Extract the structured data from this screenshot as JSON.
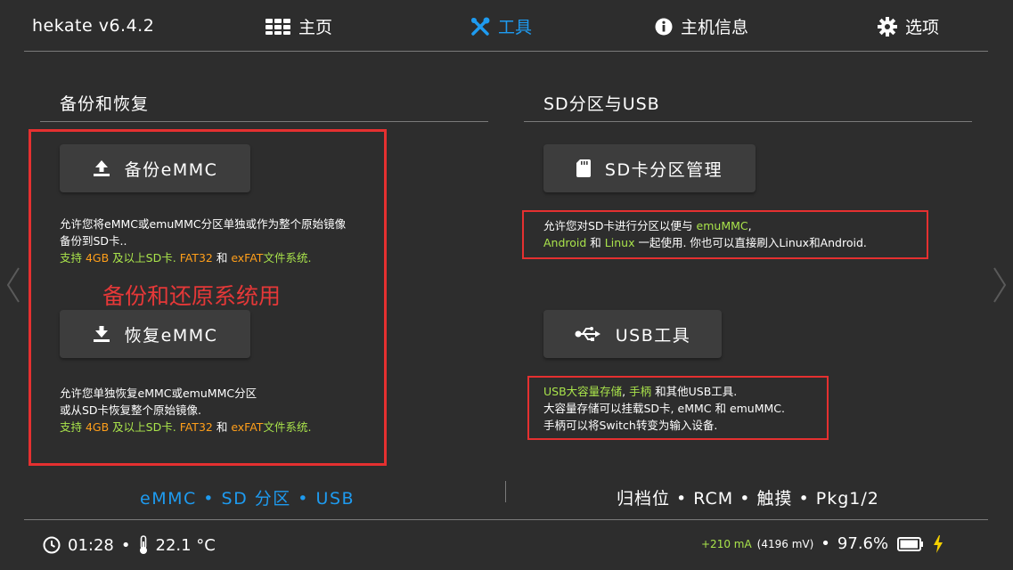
{
  "header": {
    "app_title": "hekate v6.4.2",
    "tabs": [
      {
        "label": "主页",
        "icon": "grid-icon"
      },
      {
        "label": "工具",
        "icon": "tools-icon",
        "active": true
      },
      {
        "label": "主机信息",
        "icon": "info-icon"
      },
      {
        "label": "选项",
        "icon": "gear-icon"
      }
    ]
  },
  "left": {
    "section_title": "备份和恢复",
    "backup_button": "备份eMMC",
    "backup_desc": {
      "line1": "允许您将eMMC或emuMMC分区单独或作为整个原始镜像",
      "line2": "备份到SD卡..",
      "support_prefix": "支持 ",
      "size": "4GB",
      "mid": " 及以上SD卡. ",
      "fat32": "FAT32",
      "and": " 和 ",
      "exfat": "exFAT",
      "suffix": "文件系统."
    },
    "annotation": "备份和还原系统用",
    "restore_button": "恢复eMMC",
    "restore_desc": {
      "line1": "允许您单独恢复eMMC或emuMMC分区",
      "line2": "或从SD卡恢复整个原始镜像.",
      "support_prefix": "支持 ",
      "size": "4GB",
      "mid": " 及以上SD卡. ",
      "fat32": "FAT32",
      "and": " 和 ",
      "exfat": "exFAT",
      "suffix": "文件系统."
    }
  },
  "right": {
    "section_title": "SD分区与USB",
    "sd_button": "SD卡分区管理",
    "sd_desc": {
      "line1_prefix": "允许您对SD卡进行分区以便与 ",
      "emummc": "emuMMC",
      "line1_suffix": ",",
      "android": "Android",
      "and": " 和 ",
      "linux": "Linux",
      "line2_suffix": " 一起使用. 你也可以直接刷入Linux和Android."
    },
    "usb_button": "USB工具",
    "usb_desc": {
      "ums": "USB大容量存储",
      "comma": ", ",
      "gamepad": "手柄",
      "line1_suffix": " 和其他USB工具.",
      "line2": "大容量存储可以挂载SD卡, eMMC 和 emuMMC.",
      "line3": "手柄可以将Switch转变为输入设备."
    }
  },
  "footer": {
    "left_label": "eMMC • SD 分区 • USB",
    "right_label": "归档位 • RCM • 触摸 • Pkg1/2"
  },
  "status": {
    "time": "01:28",
    "sep1": "•",
    "temp": "22.1 °C",
    "current": "+210 mA",
    "voltage": "(4196 mV)",
    "sep2": "•",
    "battery_percent": "97.6%",
    "battery_level": 0.976
  },
  "colors": {
    "accent": "#1e9bf0",
    "highlight_green": "#a9e34b",
    "highlight_orange": "#ff9f1a",
    "annotation_red": "#e53030"
  }
}
